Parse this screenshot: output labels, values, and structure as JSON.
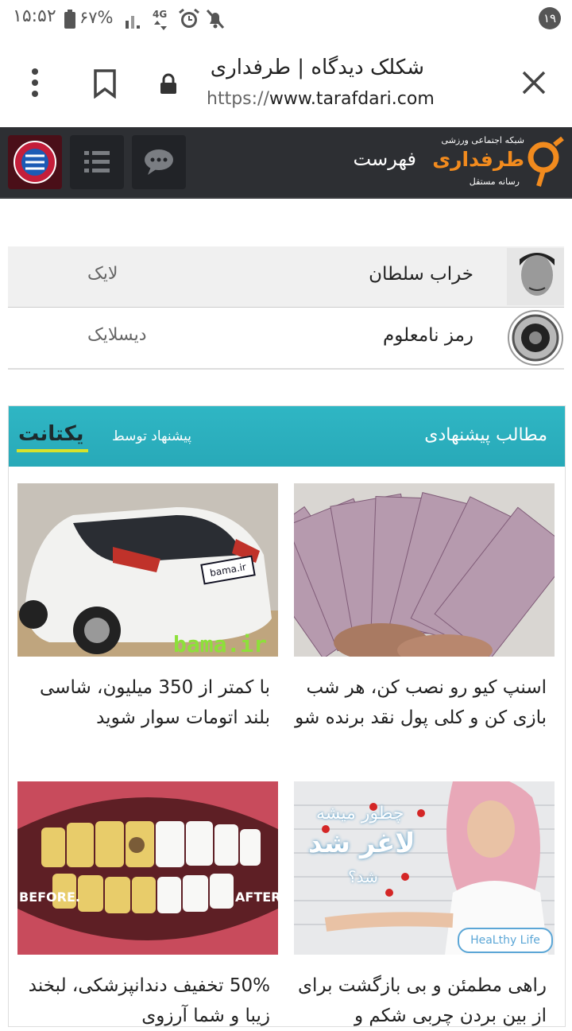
{
  "status_bar": {
    "time": "۱۵:۵۲",
    "battery": "۶۷%",
    "network": "4G",
    "notification_count": "۱۹",
    "icons": [
      "battery-icon",
      "signal-icon",
      "4g-icon",
      "alarm-icon",
      "mute-icon"
    ]
  },
  "browser": {
    "page_title": "شکلک دیدگاه | طرفداری",
    "url_scheme": "https://",
    "url_host": "www.tarafdari.com",
    "icons": [
      "close-icon",
      "lock-icon",
      "bookmark-icon",
      "more-icon"
    ]
  },
  "site_header": {
    "logo_top": "شبکه اجتماعی ورزشی",
    "logo_name": "طرفداری",
    "logo_bottom": "رسانه مستقل",
    "menu_label": "فهرست",
    "icons": [
      "chat-icon",
      "list-icon",
      "avatar-icon"
    ]
  },
  "votes": [
    {
      "user": "خراب سلطان",
      "action": "لایک"
    },
    {
      "user": "رمز نامعلوم",
      "action": "دیسلایک"
    }
  ],
  "widget": {
    "title": "مطالب پیشنهادی",
    "by_label": "پیشنهاد توسط",
    "provider": "یکتانت",
    "cards": [
      {
        "text": "اسنپ کیو رو نصب کن، هر شب بازی کن و کلی پول نقد برنده شو"
      },
      {
        "text": "با کمتر از 350 میلیون، شاسی بلند اتومات سوار شوید",
        "watermark": "bama.ir",
        "plate": "bama.ir"
      },
      {
        "text": "راهی مطمئن و بی بازگشت برای از بین بردن چربی شکم و",
        "image_text_1": "چطور میشه",
        "image_text_2": "لاغر شد",
        "image_text_3": "شد؟",
        "badge": "HeaLthy Life"
      },
      {
        "text": "50% تخفیف دندانپزشکی، لبخند زیبا و شما آرزوی",
        "before": "BEFORE.",
        "after": "AFTER."
      }
    ]
  }
}
